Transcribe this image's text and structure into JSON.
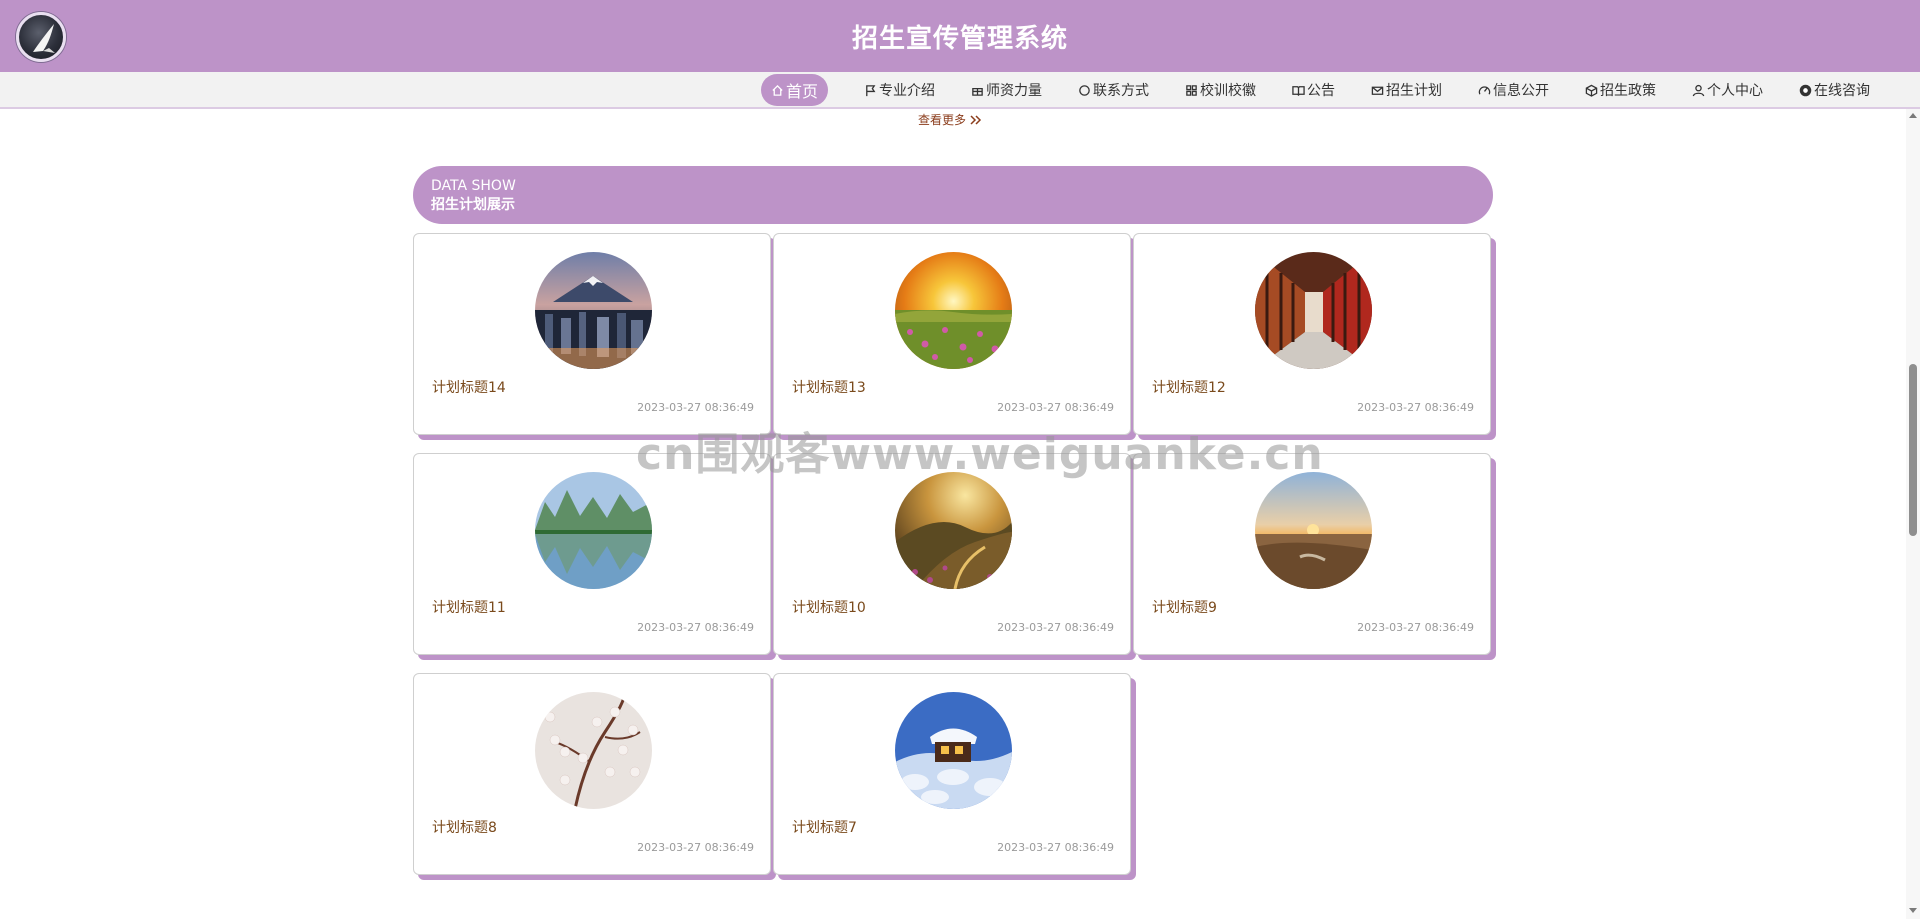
{
  "header": {
    "title": "招生宣传管理系统"
  },
  "nav": [
    {
      "label": "首页",
      "icon": "home-icon",
      "active": true
    },
    {
      "label": "专业介绍",
      "icon": "flag-icon"
    },
    {
      "label": "师资力量",
      "icon": "gift-icon"
    },
    {
      "label": "联系方式",
      "icon": "circle-icon"
    },
    {
      "label": "校训校徽",
      "icon": "grid-icon"
    },
    {
      "label": "公告",
      "icon": "book-icon"
    },
    {
      "label": "招生计划",
      "icon": "mail-icon"
    },
    {
      "label": "信息公开",
      "icon": "gauge-icon"
    },
    {
      "label": "招生政策",
      "icon": "cube-icon"
    },
    {
      "label": "个人中心",
      "icon": "user-icon"
    },
    {
      "label": "在线咨询",
      "icon": "chat-icon"
    }
  ],
  "more_link": "查看更多",
  "section": {
    "en": "DATA SHOW",
    "cn": "招生计划展示"
  },
  "plans": [
    {
      "title": "计划标题14",
      "time": "2023-03-27 08:36:49",
      "image": "city-mountain-dusk"
    },
    {
      "title": "计划标题13",
      "time": "2023-03-27 08:36:49",
      "image": "sunset-flower-field"
    },
    {
      "title": "计划标题12",
      "time": "2023-03-27 08:36:49",
      "image": "red-pillar-corridor"
    },
    {
      "title": "计划标题11",
      "time": "2023-03-27 08:36:49",
      "image": "karst-lake-reflection"
    },
    {
      "title": "计划标题10",
      "time": "2023-03-27 08:36:49",
      "image": "golden-valley"
    },
    {
      "title": "计划标题9",
      "time": "2023-03-27 08:36:49",
      "image": "desert-sunset"
    },
    {
      "title": "计划标题8",
      "time": "2023-03-27 08:36:49",
      "image": "cherry-blossom"
    },
    {
      "title": "计划标题7",
      "time": "2023-03-27 08:36:49",
      "image": "snow-cabin-night"
    }
  ],
  "watermark": "cn围观客www.weiguanke.cn",
  "colors": {
    "brand": "#bd93c8",
    "title_text": "#7a4a1c",
    "link": "#8b3d1c"
  }
}
